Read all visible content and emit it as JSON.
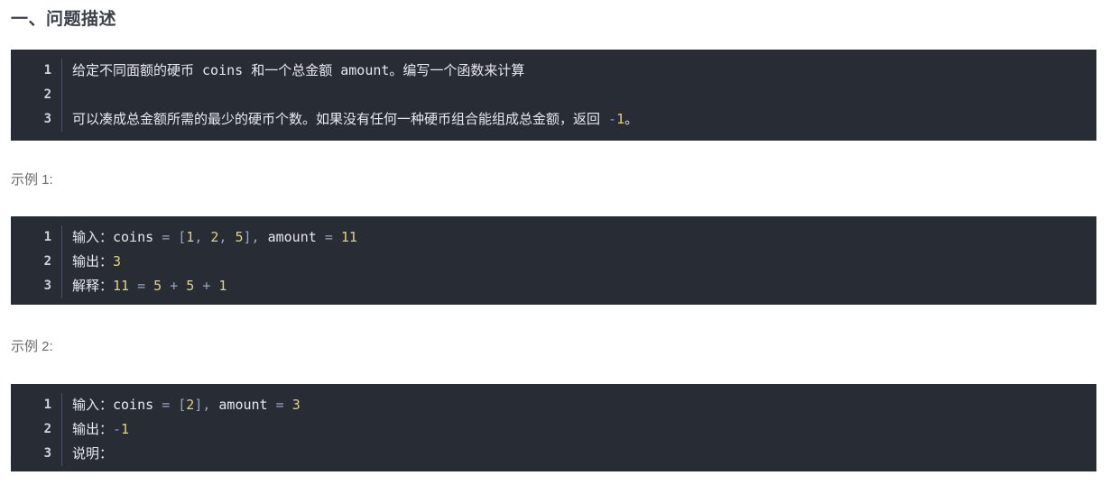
{
  "page": {
    "background": "#ffffff",
    "code_background": "#282c35"
  },
  "section": {
    "title": "一、问题描述",
    "title_color": "#3c4049"
  },
  "examples": [
    {
      "label": "示例 1:"
    },
    {
      "label": "示例 2:"
    }
  ],
  "code_blocks": [
    {
      "name": "problem-description",
      "lines": [
        {
          "number": "1",
          "tokens": [
            {
              "text": "给定不同面额的硬币 coins 和一个总金额 amount。编写一个函数来计算",
              "type": "text"
            }
          ]
        },
        {
          "number": "2",
          "tokens": []
        },
        {
          "number": "3",
          "tokens": [
            {
              "text": "可以凑成总金额所需的最少的硬币个数。如果没有任何一种硬币组合能组成总金额，返回 ",
              "type": "text"
            },
            {
              "text": "-",
              "type": "neg"
            },
            {
              "text": "1",
              "type": "num"
            },
            {
              "text": "。",
              "type": "text"
            }
          ]
        }
      ]
    },
    {
      "name": "example-1",
      "lines": [
        {
          "number": "1",
          "tokens": [
            {
              "text": "输入：coins ",
              "type": "text"
            },
            {
              "text": "=",
              "type": "op"
            },
            {
              "text": " ",
              "type": "text"
            },
            {
              "text": "[",
              "type": "punc"
            },
            {
              "text": "1",
              "type": "num"
            },
            {
              "text": ",",
              "type": "punc"
            },
            {
              "text": " ",
              "type": "text"
            },
            {
              "text": "2",
              "type": "num"
            },
            {
              "text": ",",
              "type": "punc"
            },
            {
              "text": " ",
              "type": "text"
            },
            {
              "text": "5",
              "type": "num"
            },
            {
              "text": "]",
              "type": "punc"
            },
            {
              "text": ",",
              "type": "punc"
            },
            {
              "text": " amount ",
              "type": "text"
            },
            {
              "text": "=",
              "type": "op"
            },
            {
              "text": " ",
              "type": "text"
            },
            {
              "text": "11",
              "type": "num"
            }
          ]
        },
        {
          "number": "2",
          "tokens": [
            {
              "text": "输出：",
              "type": "text"
            },
            {
              "text": "3",
              "type": "num"
            }
          ]
        },
        {
          "number": "3",
          "tokens": [
            {
              "text": "解释：",
              "type": "text"
            },
            {
              "text": "11",
              "type": "num"
            },
            {
              "text": " ",
              "type": "text"
            },
            {
              "text": "=",
              "type": "op"
            },
            {
              "text": " ",
              "type": "text"
            },
            {
              "text": "5",
              "type": "num"
            },
            {
              "text": " ",
              "type": "text"
            },
            {
              "text": "+",
              "type": "op"
            },
            {
              "text": " ",
              "type": "text"
            },
            {
              "text": "5",
              "type": "num"
            },
            {
              "text": " ",
              "type": "text"
            },
            {
              "text": "+",
              "type": "op"
            },
            {
              "text": " ",
              "type": "text"
            },
            {
              "text": "1",
              "type": "num"
            }
          ]
        }
      ]
    },
    {
      "name": "example-2",
      "lines": [
        {
          "number": "1",
          "tokens": [
            {
              "text": "输入：coins ",
              "type": "text"
            },
            {
              "text": "=",
              "type": "op"
            },
            {
              "text": " ",
              "type": "text"
            },
            {
              "text": "[",
              "type": "punc"
            },
            {
              "text": "2",
              "type": "num"
            },
            {
              "text": "]",
              "type": "punc"
            },
            {
              "text": ",",
              "type": "punc"
            },
            {
              "text": " amount ",
              "type": "text"
            },
            {
              "text": "=",
              "type": "op"
            },
            {
              "text": " ",
              "type": "text"
            },
            {
              "text": "3",
              "type": "num"
            }
          ]
        },
        {
          "number": "2",
          "tokens": [
            {
              "text": "输出：",
              "type": "text"
            },
            {
              "text": "-",
              "type": "neg"
            },
            {
              "text": "1",
              "type": "num"
            }
          ]
        },
        {
          "number": "3",
          "tokens": [
            {
              "text": "说明：",
              "type": "text"
            }
          ]
        }
      ]
    }
  ]
}
